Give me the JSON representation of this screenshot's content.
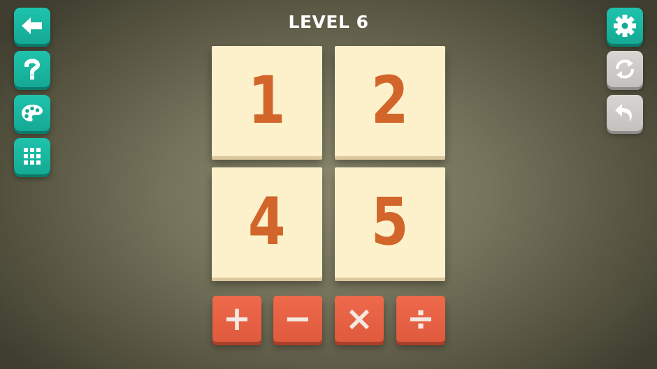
{
  "header": {
    "level_title": "LEVEL 6"
  },
  "left_toolbar": [
    {
      "icon": "back-arrow-icon",
      "action": "back"
    },
    {
      "icon": "question-mark-icon",
      "action": "help"
    },
    {
      "icon": "palette-icon",
      "action": "theme"
    },
    {
      "icon": "grid-icon",
      "action": "levels"
    }
  ],
  "right_toolbar": [
    {
      "icon": "gear-icon",
      "action": "settings",
      "enabled": true
    },
    {
      "icon": "refresh-icon",
      "action": "restart",
      "enabled": false
    },
    {
      "icon": "undo-icon",
      "action": "undo",
      "enabled": false
    }
  ],
  "board": {
    "tiles": [
      {
        "value": "1"
      },
      {
        "value": "2"
      },
      {
        "value": "4"
      },
      {
        "value": "5"
      }
    ]
  },
  "operators": [
    {
      "symbol": "+",
      "name": "add"
    },
    {
      "symbol": "−",
      "name": "subtract"
    },
    {
      "symbol": "×",
      "name": "multiply"
    },
    {
      "symbol": "÷",
      "name": "divide"
    }
  ],
  "colors": {
    "teal_button": "#1ab8a2",
    "grey_button": "#cfcbc8",
    "tile_face": "#fdf1cc",
    "tile_number": "#d2652a",
    "operator_button": "#e8623f",
    "background": "#75735c"
  }
}
